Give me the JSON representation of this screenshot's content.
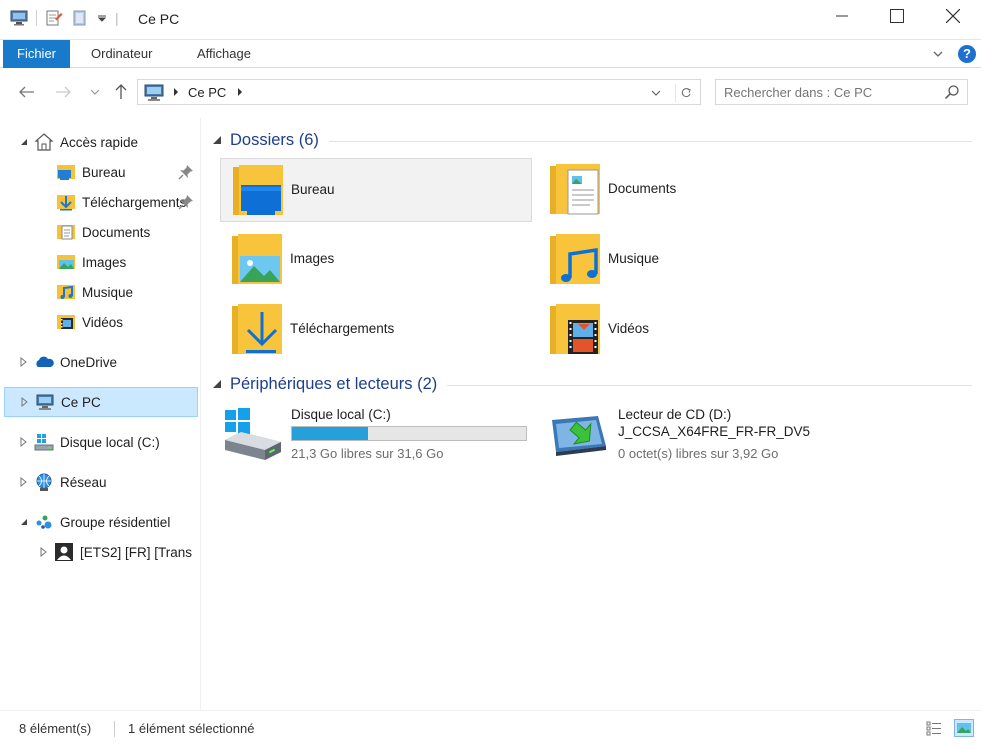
{
  "window": {
    "title": "Ce PC"
  },
  "ribbon": {
    "tabs": [
      {
        "label": "Fichier"
      },
      {
        "label": "Ordinateur"
      },
      {
        "label": "Affichage"
      }
    ],
    "help_label": "?"
  },
  "address": {
    "crumb": "Ce PC"
  },
  "search": {
    "placeholder": "Rechercher dans : Ce PC"
  },
  "navpane": {
    "items": [
      {
        "label": "Accès rapide"
      },
      {
        "label": "Bureau"
      },
      {
        "label": "Téléchargements"
      },
      {
        "label": "Documents"
      },
      {
        "label": "Images"
      },
      {
        "label": "Musique"
      },
      {
        "label": "Vidéos"
      },
      {
        "label": "OneDrive"
      },
      {
        "label": "Ce PC"
      },
      {
        "label": "Disque local (C:)"
      },
      {
        "label": "Réseau"
      },
      {
        "label": "Groupe résidentiel"
      },
      {
        "label": "[ETS2] [FR] [Trans"
      }
    ]
  },
  "content": {
    "folders_header": "Dossiers (6)",
    "folders": [
      {
        "label": "Bureau"
      },
      {
        "label": "Documents"
      },
      {
        "label": "Images"
      },
      {
        "label": "Musique"
      },
      {
        "label": "Téléchargements"
      },
      {
        "label": "Vidéos"
      }
    ],
    "devices_header": "Périphériques et lecteurs (2)",
    "drives": [
      {
        "name": "Disque local (C:)",
        "free": "21,3 Go libres sur 31,6 Go",
        "used_fraction": 0.326
      },
      {
        "name": "Lecteur de CD (D:)",
        "name2": "J_CCSA_X64FRE_FR-FR_DV5",
        "free": "0 octet(s) libres sur 3,92 Go"
      }
    ]
  },
  "status": {
    "count": "8 élément(s)",
    "selected": "1 élément sélectionné"
  },
  "colors": {
    "accent": "#1979ca",
    "selection": "#cce8ff",
    "group_title": "#1d3f8c",
    "progress": "#26a0da"
  }
}
